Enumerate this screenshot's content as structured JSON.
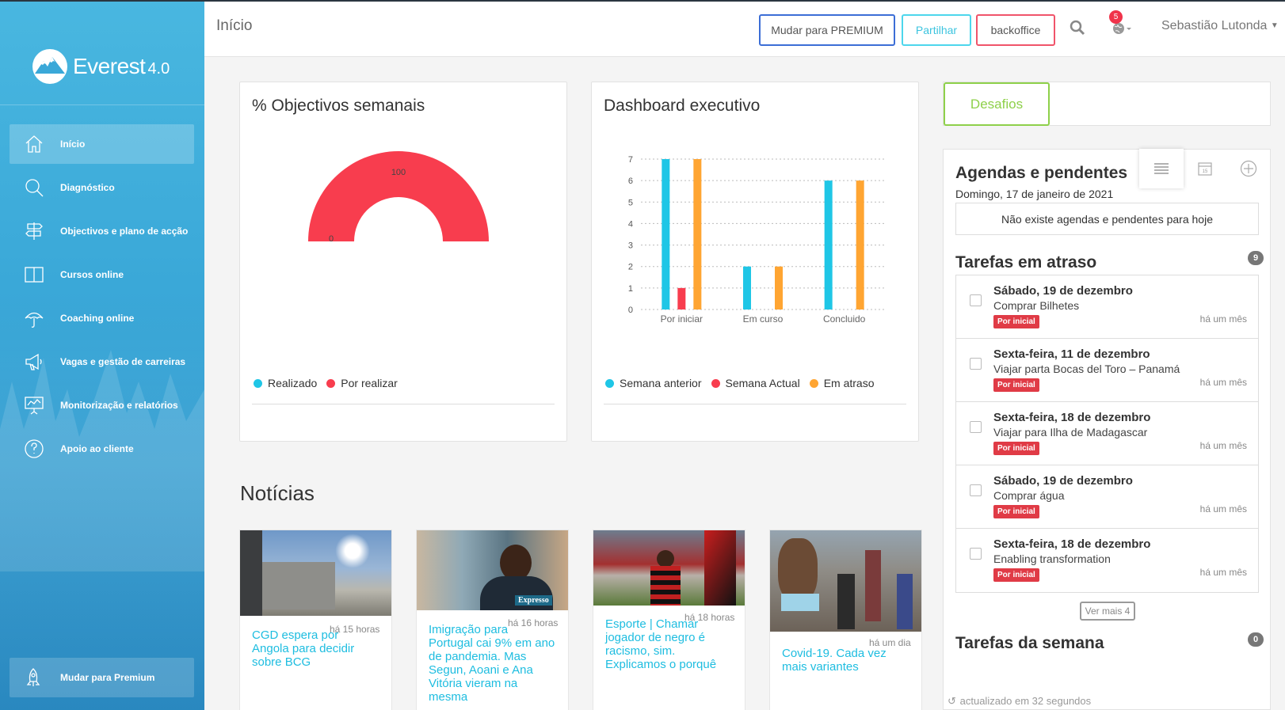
{
  "app": {
    "brand": "Everest",
    "version": "4.0"
  },
  "sidebar": {
    "items": [
      {
        "label": "Início",
        "icon": "home-icon"
      },
      {
        "label": "Diagnóstico",
        "icon": "search-icon"
      },
      {
        "label": "Objectivos e plano de acção",
        "icon": "signpost-icon"
      },
      {
        "label": "Cursos online",
        "icon": "book-icon"
      },
      {
        "label": "Coaching online",
        "icon": "umbrella-icon"
      },
      {
        "label": "Vagas e gestão de carreiras",
        "icon": "megaphone-icon"
      },
      {
        "label": "Monitorização e relatórios",
        "icon": "presentation-icon"
      },
      {
        "label": "Apoio ao cliente",
        "icon": "help-icon"
      }
    ],
    "premium_label": "Mudar para Premium"
  },
  "header": {
    "title": "Início",
    "premium_button": "Mudar para PREMIUM",
    "share_button": "Partilhar",
    "backoffice_button": "backoffice",
    "notification_count": "5",
    "user_name": "Sebastião Lutonda"
  },
  "weekly": {
    "title": "% Objectivos semanais",
    "legend": [
      "Realizado",
      "Por realizar"
    ]
  },
  "dashboard": {
    "title": "Dashboard executivo",
    "legend": [
      "Semana anterior",
      "Semana Actual",
      "Em atraso"
    ]
  },
  "chart_data": [
    {
      "type": "pie",
      "title": "% Objectivos semanais",
      "labels": [
        "Realizado",
        "Por realizar"
      ],
      "values": [
        0,
        100
      ],
      "data_labels": [
        "0",
        "100"
      ],
      "colors": [
        "#1fc6e6",
        "#f83d4e"
      ],
      "legend": "bottom-left"
    },
    {
      "type": "bar",
      "title": "Dashboard executivo",
      "categories": [
        "Por iniciar",
        "Em curso",
        "Concluido"
      ],
      "series": [
        {
          "name": "Semana anterior",
          "values": [
            7,
            2,
            6
          ],
          "color": "#1fc6e6"
        },
        {
          "name": "Semana Actual",
          "values": [
            1,
            0,
            0
          ],
          "color": "#f83d4e"
        },
        {
          "name": "Em atraso",
          "values": [
            7,
            2,
            6
          ],
          "color": "#ffa532"
        }
      ],
      "ylim": [
        0,
        7
      ],
      "yticks": [
        "0",
        "1",
        "2",
        "3",
        "4",
        "5",
        "6",
        "7"
      ],
      "grid": true,
      "legend": "bottom-left"
    }
  ],
  "news": {
    "title": "Notícias",
    "items": [
      {
        "time": "há 15 horas",
        "headline": "CGD espera por Angola para decidir sobre BCG"
      },
      {
        "time": "há 16 horas",
        "headline": "Imigração para Portugal cai 9% em ano de pandemia. Mas Segun, Aoani e Ana Vitória vieram na mesma",
        "badge": "Expresso"
      },
      {
        "time": "há 18 horas",
        "headline": "Esporte | Chamar jogador de negro é racismo, sim. Explicamos o porquê"
      },
      {
        "time": "há um dia",
        "headline": "Covid-19. Cada vez mais variantes"
      }
    ]
  },
  "right": {
    "tab_label": "Desafios",
    "agenda_title": "Agendas e pendentes",
    "agenda_date": "Domingo, 17 de janeiro de 2021",
    "agenda_empty": "Não existe agendas e pendentes para hoje",
    "calendar_day": "15",
    "overdue_title": "Tarefas em atraso",
    "overdue_count": "9",
    "tasks": [
      {
        "date": "Sábado, 19 de dezembro",
        "name": "Comprar Bilhetes",
        "status": "Por inicial",
        "age": "há um mês"
      },
      {
        "date": "Sexta-feira, 11 de dezembro",
        "name": "Viajar parta Bocas del Toro – Panamá",
        "status": "Por inicial",
        "age": "há um mês"
      },
      {
        "date": "Sexta-feira, 18 de dezembro",
        "name": "Viajar para Ilha de Madagascar",
        "status": "Por inicial",
        "age": "há um mês"
      },
      {
        "date": "Sábado, 19 de dezembro",
        "name": "Comprar água",
        "status": "Por inicial",
        "age": "há um mês"
      },
      {
        "date": "Sexta-feira, 18 de dezembro",
        "name": "Enabling transformation",
        "status": "Por inicial",
        "age": "há um mês"
      }
    ],
    "more_label": "Ver mais 4",
    "week_title": "Tarefas da semana",
    "week_count": "0",
    "updated": "actualizado em 32 segundos"
  },
  "colors": {
    "accent": "#3aa8d8",
    "cyan": "#1fc6e6",
    "red": "#f83d4e",
    "orange": "#ffa532",
    "green": "#8ed04a"
  }
}
